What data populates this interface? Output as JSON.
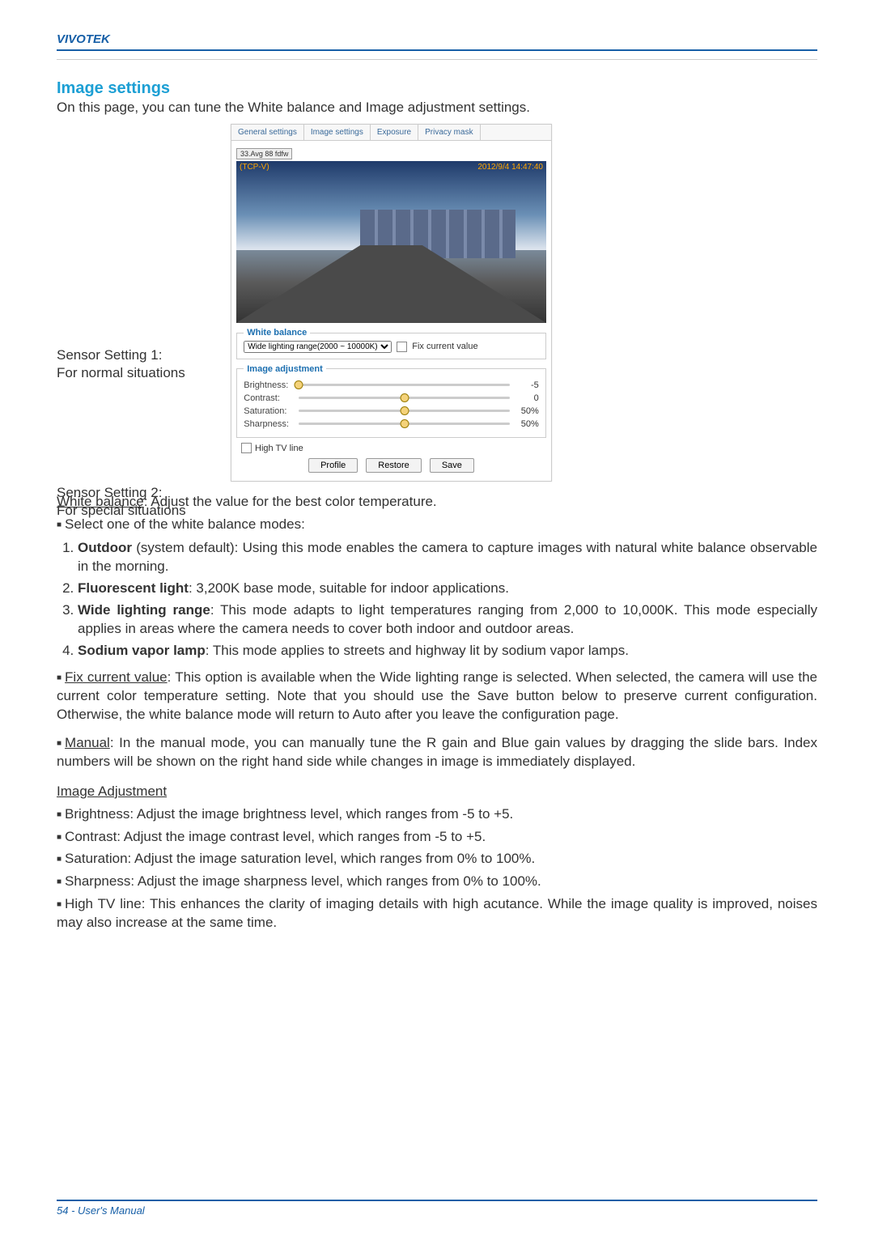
{
  "brand": "VIVOTEK",
  "section_title": "Image settings",
  "intro": "On this page, you can tune the White balance and Image adjustment settings.",
  "sensor_labels": {
    "s1_a": "Sensor Setting 1:",
    "s1_b": "For normal situations",
    "s2_a": "Sensor Setting 2:",
    "s2_b": "For special situations"
  },
  "panel": {
    "tabs": [
      "General settings",
      "Image settings",
      "Exposure",
      "Privacy mask"
    ],
    "fps": "33.Avg 88 fdfw",
    "video_label": "(TCP-V)",
    "video_time": "2012/9/4 14:47:40",
    "wb": {
      "legend": "White balance",
      "select": "Wide lighting range(2000 ~ 10000K)",
      "fix": "Fix current value"
    },
    "adj": {
      "legend": "Image adjustment",
      "brightness": {
        "label": "Brightness:",
        "value": "-5",
        "pct": 0
      },
      "contrast": {
        "label": "Contrast:",
        "value": "0",
        "pct": 50
      },
      "saturation": {
        "label": "Saturation:",
        "value": "50%",
        "pct": 50
      },
      "sharpness": {
        "label": "Sharpness:",
        "value": "50%",
        "pct": 50
      }
    },
    "tvline": "High TV line",
    "buttons": {
      "profile": "Profile",
      "restore": "Restore",
      "save": "Save"
    }
  },
  "wb_title": "White balance",
  "wb_intro_rest": ": Adjust the value for the best color temperature.",
  "wb_mode_intro": "Select one of the white balance modes:",
  "modes": {
    "m1_name": "Outdoor",
    "m1_rest": " (system default): Using this mode enables the camera to capture images with natural white balance observable in the morning.",
    "m2_name": "Fluorescent light",
    "m2_rest": ": 3,200K base mode, suitable for indoor applications.",
    "m3_name": "Wide lighting range",
    "m3_rest": ": This mode adapts to light temperatures ranging from 2,000 to 10,000K. This mode especially applies in areas where the camera needs to cover both indoor and outdoor areas.",
    "m4_name": "Sodium vapor lamp",
    "m4_rest": ": This mode applies to streets and highway lit by sodium vapor lamps."
  },
  "fix_title": "Fix current value",
  "fix_rest": ": This option is available when the Wide lighting range is selected. When selected, the camera will use the current color temperature setting. Note that you should use the Save button below to preserve current configuration. Otherwise, the white balance mode will return to Auto after you leave the configuration page.",
  "manual_title": "Manual",
  "manual_rest": ": In the manual mode, you can manually tune the R gain and Blue gain values by dragging the slide bars. Index numbers will be shown on the right hand side while changes in image is immediately displayed.",
  "img_adj_title": "Image Adjustment",
  "img_adj": {
    "brightness": "Brightness: Adjust the image brightness level, which ranges from -5 to +5.",
    "contrast": "Contrast: Adjust the image contrast level, which ranges from -5 to +5.",
    "saturation": "Saturation: Adjust the image saturation level, which ranges from 0% to 100%.",
    "sharpness": "Sharpness: Adjust the image sharpness level, which ranges from 0% to 100%.",
    "tvline": "High TV line: This enhances the clarity of imaging details with high acutance. While the image quality is improved, noises may also increase at the same time."
  },
  "footer_page": "54 - User's Manual"
}
